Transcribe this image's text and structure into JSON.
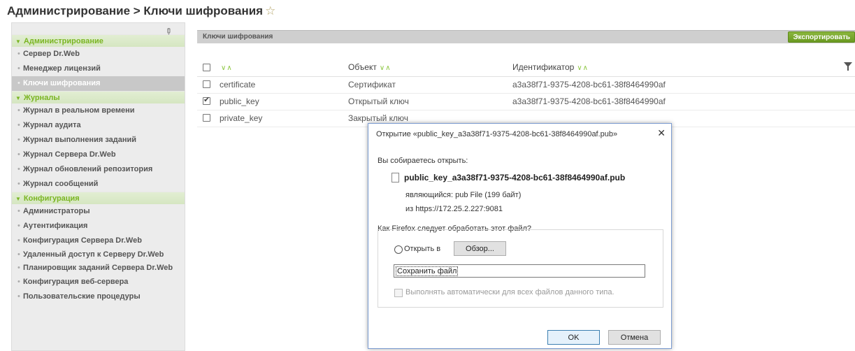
{
  "breadcrumb": "Администрирование > Ключи шифрования",
  "star": "☆",
  "sidebar": {
    "sections": [
      {
        "title": "Администрирование",
        "items": [
          "Сервер Dr.Web",
          "Менеджер лицензий",
          "Ключи шифрования"
        ]
      },
      {
        "title": "Журналы",
        "items": [
          "Журнал в реальном времени",
          "Журнал аудита",
          "Журнал выполнения заданий",
          "Журнал Сервера Dr.Web",
          "Журнал обновлений репозитория",
          "Журнал сообщений"
        ]
      },
      {
        "title": "Конфигурация",
        "items": [
          "Администраторы",
          "Аутентификация",
          "Конфигурация Сервера Dr.Web",
          "Удаленный доступ к Серверу Dr.Web",
          "Планировщик заданий Сервера Dr.Web",
          "Конфигурация веб-сервера",
          "Пользовательские процедуры"
        ]
      }
    ]
  },
  "content": {
    "title": "Ключи шифрования",
    "export_label": "Экспортировать"
  },
  "table": {
    "sort_glyph": "∨∧",
    "columns": [
      "",
      "Объект",
      "Идентификатор"
    ],
    "rows": [
      {
        "name": "certificate",
        "object": "Сертификат",
        "id": "a3a38f71-9375-4208-bc61-38f8464990af",
        "checked": false
      },
      {
        "name": "public_key",
        "object": "Открытый ключ",
        "id": "a3a38f71-9375-4208-bc61-38f8464990af",
        "checked": true
      },
      {
        "name": "private_key",
        "object": "Закрытый ключ",
        "id": "",
        "checked": false
      }
    ]
  },
  "dialog": {
    "title": "Открытие «public_key_a3a38f71-9375-4208-bc61-38f8464990af.pub»",
    "close": "✕",
    "intro": "Вы собираетесь открыть:",
    "filename": "public_key_a3a38f71-9375-4208-bc61-38f8464990af.pub",
    "type_line": "являющийся:  pub File (199 байт)",
    "from_line": "из https://172.25.2.227:9081",
    "question": "Как Firefox следует обработать этот файл?",
    "open_with_label": "Открыть в",
    "browse_label": "Обзор...",
    "save_label": "Сохранить файл",
    "auto_label": "Выполнять автоматически для всех файлов данного типа.",
    "ok_label": "OK",
    "cancel_label": "Отмена"
  }
}
